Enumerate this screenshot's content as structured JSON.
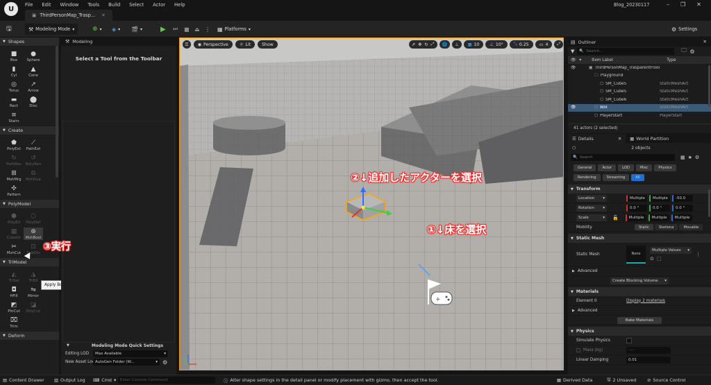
{
  "menu": [
    "File",
    "Edit",
    "Window",
    "Tools",
    "Build",
    "Select",
    "Actor",
    "Help"
  ],
  "level_tab": "ThirdPersonMap_Trasp...",
  "project_name": "Blog_20230117",
  "toolbar": {
    "mode": "Modeling Mode",
    "platforms": "Platforms",
    "settings": "Settings"
  },
  "shapes_panel": {
    "categories": [
      {
        "name": "Shapes",
        "tools": [
          {
            "label": "Box",
            "icon": "■"
          },
          {
            "label": "Sphere",
            "icon": "●"
          },
          {
            "label": "Cyl",
            "icon": "▮"
          },
          {
            "label": "Cone",
            "icon": "▲"
          },
          {
            "label": "Torus",
            "icon": "◎"
          },
          {
            "label": "Arrow",
            "icon": "↗"
          },
          {
            "label": "Rect",
            "icon": "▬"
          },
          {
            "label": "Disc",
            "icon": "⬤"
          },
          {
            "label": "Stairs",
            "icon": "≡"
          }
        ]
      },
      {
        "name": "Create",
        "tools": [
          {
            "label": "PolyExt",
            "icon": "⬟"
          },
          {
            "label": "PathExt",
            "icon": "⟋"
          },
          {
            "label": "PathRev",
            "icon": "↻"
          },
          {
            "label": "BdryRev",
            "icon": "↺"
          },
          {
            "label": "MshMrg",
            "icon": "⊞"
          },
          {
            "label": "MshDup",
            "icon": "⧉"
          },
          {
            "label": "Pattern",
            "icon": "✣"
          }
        ]
      },
      {
        "name": "PolyModel",
        "tools": [
          {
            "label": "PolyEd",
            "icon": "⬢"
          },
          {
            "label": "PolyDef",
            "icon": "⬡"
          },
          {
            "label": "CubeGr",
            "icon": "▦"
          },
          {
            "label": "MshBool",
            "icon": "⊛"
          },
          {
            "label": "MshCut",
            "icon": "✂"
          },
          {
            "label": "SubDiv",
            "icon": "⊡"
          }
        ]
      },
      {
        "name": "TriModel",
        "tools": [
          {
            "label": "TriSel",
            "icon": "◭"
          },
          {
            "label": "TriEd",
            "icon": "◮"
          },
          {
            "label": "HFill",
            "icon": "◘"
          },
          {
            "label": "Mirror",
            "icon": "⇋"
          },
          {
            "label": "PlnCut",
            "icon": "◩"
          },
          {
            "label": "PolyCut",
            "icon": "◪"
          },
          {
            "label": "Trim",
            "icon": "⌧"
          }
        ]
      },
      {
        "name": "Deform",
        "tools": []
      }
    ],
    "tooltip": "Apply Boolean operations to mesh pairs"
  },
  "modeling_panel": {
    "tab": "Modeling",
    "message": "Select a Tool from the Toolbar",
    "quick_settings": {
      "title": "Modeling Mode Quick Settings",
      "editing_lod_label": "Editing LOD",
      "editing_lod_value": "Max Available",
      "asset_location_label": "New Asset Location",
      "asset_location_value": "AutoGen Folder (W..."
    }
  },
  "viewport": {
    "perspective": "Perspective",
    "lit": "Lit",
    "show": "Show",
    "grid_snap": "10",
    "rot_snap": "10°",
    "scale_snap": "0.25",
    "cam_speed": "4"
  },
  "annotations": {
    "select_actor": "②↓追加したアクターを選択",
    "select_floor": "①↓床を選択",
    "execute": "③実行"
  },
  "outliner": {
    "title": "Outliner",
    "search_placeholder": "Search...",
    "col_label": "Item Label",
    "col_type": "Type",
    "rows": [
      {
        "label": "ThirdPersonMap_TrasparentFloor (Editor)",
        "type": "",
        "indent": 1,
        "selected": false
      },
      {
        "label": "Playground",
        "type": "",
        "indent": 2,
        "selected": false
      },
      {
        "label": "SM_Cube5",
        "type": "StaticMeshAct",
        "indent": 3,
        "selected": false
      },
      {
        "label": "SM_Cube5",
        "type": "StaticMeshAct",
        "indent": 3,
        "selected": false
      },
      {
        "label": "SM_Cube6",
        "type": "StaticMeshAct",
        "indent": 3,
        "selected": false
      },
      {
        "label": "Box",
        "type": "StaticMeshAct",
        "indent": 2,
        "selected": true
      },
      {
        "label": "PlayerStart",
        "type": "PlayerStart",
        "indent": 2,
        "selected": false
      }
    ],
    "footer": "41 actors (2 selected)"
  },
  "details": {
    "tab_details": "Details",
    "tab_world": "World Partition",
    "object_count": "2 objects",
    "search_placeholder": "Search",
    "filters_row1": [
      "General",
      "Actor",
      "LOD",
      "Misc",
      "Physics"
    ],
    "filters_row2": [
      "Rendering",
      "Streaming",
      "All"
    ],
    "transform": {
      "title": "Transform",
      "location_label": "Location",
      "location": [
        "Multiple",
        "Multiple",
        "-50.0"
      ],
      "rotation_label": "Rotation",
      "rotation": [
        "0.0 °",
        "0.0 °",
        "0.0 °"
      ],
      "scale_label": "Scale",
      "scale": [
        "Multiple",
        "Multiple",
        "Multiple"
      ],
      "mobility_label": "Mobility",
      "mobility": [
        "Static",
        "Stationa",
        "Movable"
      ]
    },
    "static_mesh": {
      "title": "Static Mesh",
      "label": "Static Mesh",
      "thumb": "None",
      "value": "Multiple Values",
      "advanced": "Advanced",
      "create_blocking": "Create Blocking Volume"
    },
    "materials": {
      "title": "Materials",
      "element_label": "Element 0",
      "element_value": "Display 2 materials",
      "advanced": "Advanced",
      "bake": "Bake Materials"
    },
    "physics": {
      "title": "Physics",
      "simulate": "Simulate Physics",
      "mass": "Mass (kg)",
      "mass_value": "----",
      "linear_damping": "Linear Damping",
      "linear_damping_value": "0.01"
    }
  },
  "status": {
    "content_drawer": "Content Drawer",
    "output_log": "Output Log",
    "cmd": "Cmd",
    "console_placeholder": "Enter Console Command",
    "message": "Alter shape settings in the detail panel or modify placement with gizmo, then accept the tool.",
    "derived_data": "Derived Data",
    "unsaved": "2 Unsaved",
    "source_control": "Source Control"
  },
  "colors": {
    "accent": "#ff9b00",
    "selected_row": "#3a5a78",
    "all_filter": "#1f6fd0",
    "annotation_glow": "#ff2a2a"
  }
}
